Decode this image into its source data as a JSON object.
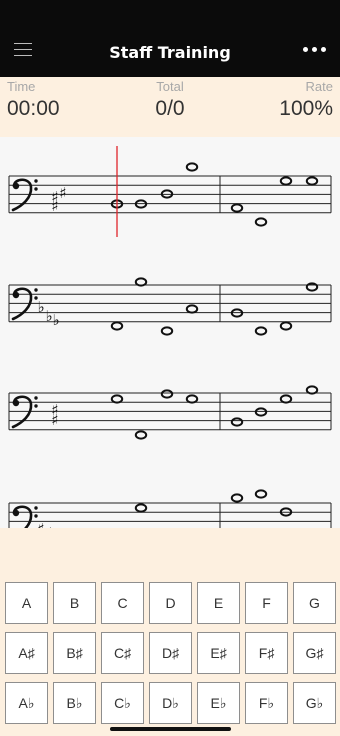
{
  "header": {
    "title": "Staff Training",
    "menu_icon": "hamburger-menu-icon",
    "more_icon": "more-horizontal-icon"
  },
  "stats": [
    {
      "label": "Time",
      "value": "00:00"
    },
    {
      "label": "Total",
      "value": "0/0"
    },
    {
      "label": "Rate",
      "value": "100%"
    }
  ],
  "colors": {
    "header_bg": "#0b0b0b",
    "panel_bg": "#fdf0e0",
    "cursor": "#e0242b",
    "staff_line": "#222222"
  },
  "staff": {
    "clef": "bass",
    "systems": [
      {
        "key_signature": "3 sharps",
        "accidentals": [
          "♯",
          "♯",
          "♯"
        ],
        "cursor_visible": true
      },
      {
        "key_signature": "3 flats",
        "accidentals": [
          "♭",
          "♭",
          "♭"
        ],
        "cursor_visible": false
      },
      {
        "key_signature": "2 sharps",
        "accidentals": [
          "♯",
          "♯"
        ],
        "cursor_visible": false
      },
      {
        "key_signature": "4 sharps",
        "accidentals": [
          "♯",
          "♯",
          "♯",
          "♯"
        ],
        "cursor_visible": false
      }
    ]
  },
  "keyboard": {
    "rows": [
      [
        "A",
        "B",
        "C",
        "D",
        "E",
        "F",
        "G"
      ],
      [
        "A♯",
        "B♯",
        "C♯",
        "D♯",
        "E♯",
        "F♯",
        "G♯"
      ],
      [
        "A♭",
        "B♭",
        "C♭",
        "D♭",
        "E♭",
        "F♭",
        "G♭"
      ]
    ]
  }
}
